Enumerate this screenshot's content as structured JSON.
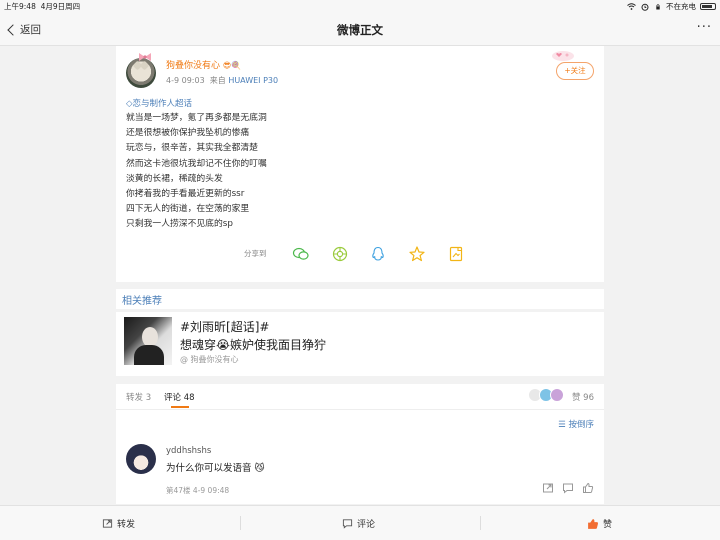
{
  "status_bar": {
    "time": "上午9:48",
    "date": "4月9日周四",
    "charge_text": "不在充电"
  },
  "nav": {
    "back_label": "返回",
    "title": "微博正文",
    "more_label": "···"
  },
  "post": {
    "username": "狗叠你没有心",
    "username_emojis": "😎🍭",
    "time": "4-9 09:03",
    "source_prefix": "来自",
    "device": "HUAWEI P30",
    "follow_label": "+关注",
    "topic": "恋与制作人超话",
    "lines": [
      "就当是一场梦，氪了再多都是无底洞",
      "还是很想被你保护我坠机的惨痛",
      "玩恋与，很辛苦，其实我全都清楚",
      "然而这卡池很坑我却记不住你的叮嘱",
      "淡黄的长裙，稀疏的头发",
      "你拷着我的手看最近更新的ssr",
      "四下无人的街道，在空荡的家里",
      "只剩我一人捞深不见底的sp"
    ],
    "share_label": "分享到"
  },
  "related": {
    "header": "相关推荐",
    "title_line1": "#刘雨昕[超话]#",
    "title_line2": "想魂穿😭嫉妒使我面目狰狞",
    "source": "@ 狗叠你没有心"
  },
  "comments": {
    "tab_repost": "转发 3",
    "tab_comment": "评论 48",
    "likes": "赞 96",
    "sort_label": "按倒序",
    "item": {
      "name": "yddhshshs",
      "text": "为什么你可以发语音",
      "emoji": "😼",
      "meta": "第47楼 4-9 09:48"
    }
  },
  "bottom_bar": {
    "repost": "转发",
    "comment": "评论",
    "like": "赞"
  },
  "colors": {
    "accent": "#f07a14",
    "link": "#4c7fb8",
    "like_active": "#f26d32"
  }
}
